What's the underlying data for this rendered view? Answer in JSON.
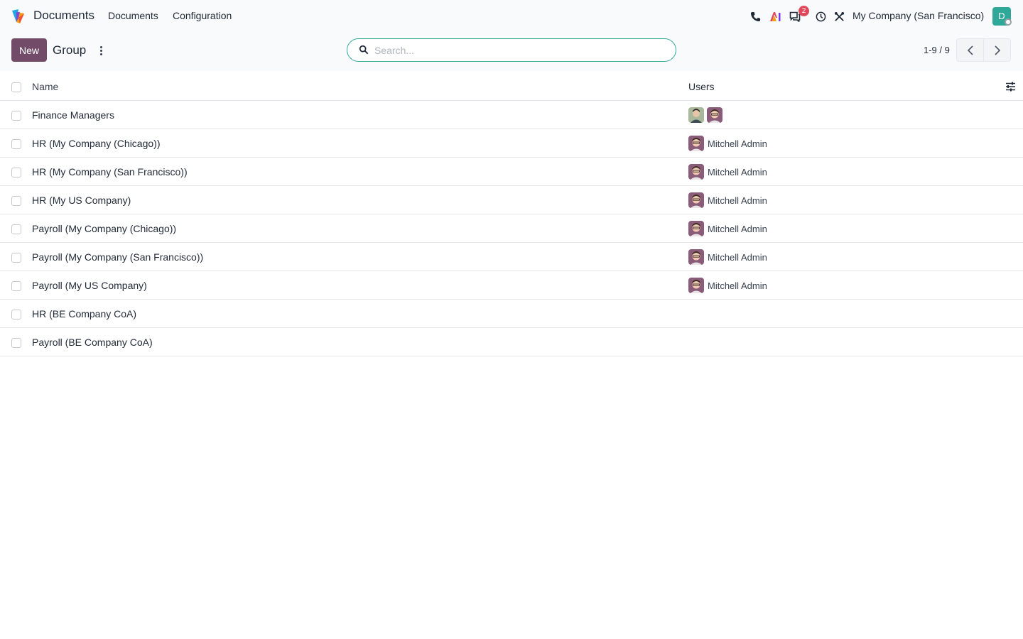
{
  "navbar": {
    "app_name": "Documents",
    "menus": [
      "Documents",
      "Configuration"
    ],
    "chat_badge": "2",
    "company": "My Company (San Francisco)",
    "user_initial": "D",
    "icons": [
      "phone-icon",
      "ai-icon",
      "chat-icon",
      "clock-icon",
      "tools-icon"
    ]
  },
  "control_panel": {
    "new_label": "New",
    "breadcrumb": "Group",
    "search_placeholder": "Search...",
    "pager": "1-9 / 9"
  },
  "list": {
    "columns": {
      "name": "Name",
      "users": "Users"
    },
    "rows": [
      {
        "name": "Finance Managers",
        "users": [],
        "avatars": [
          "avatar-green",
          "avatar-purple"
        ]
      },
      {
        "name": "HR (My Company (Chicago))",
        "user": "Mitchell Admin"
      },
      {
        "name": "HR (My Company (San Francisco))",
        "user": "Mitchell Admin"
      },
      {
        "name": "HR (My US Company)",
        "user": "Mitchell Admin"
      },
      {
        "name": "Payroll (My Company (Chicago))",
        "user": "Mitchell Admin"
      },
      {
        "name": "Payroll (My Company (San Francisco))",
        "user": "Mitchell Admin"
      },
      {
        "name": "Payroll (My US Company)",
        "user": "Mitchell Admin"
      },
      {
        "name": "HR (BE Company CoA)",
        "user": ""
      },
      {
        "name": "Payroll (BE Company CoA)",
        "user": ""
      }
    ]
  },
  "colors": {
    "primary": "#714b67",
    "accent": "#2fa89a",
    "badge": "#e0475b"
  }
}
